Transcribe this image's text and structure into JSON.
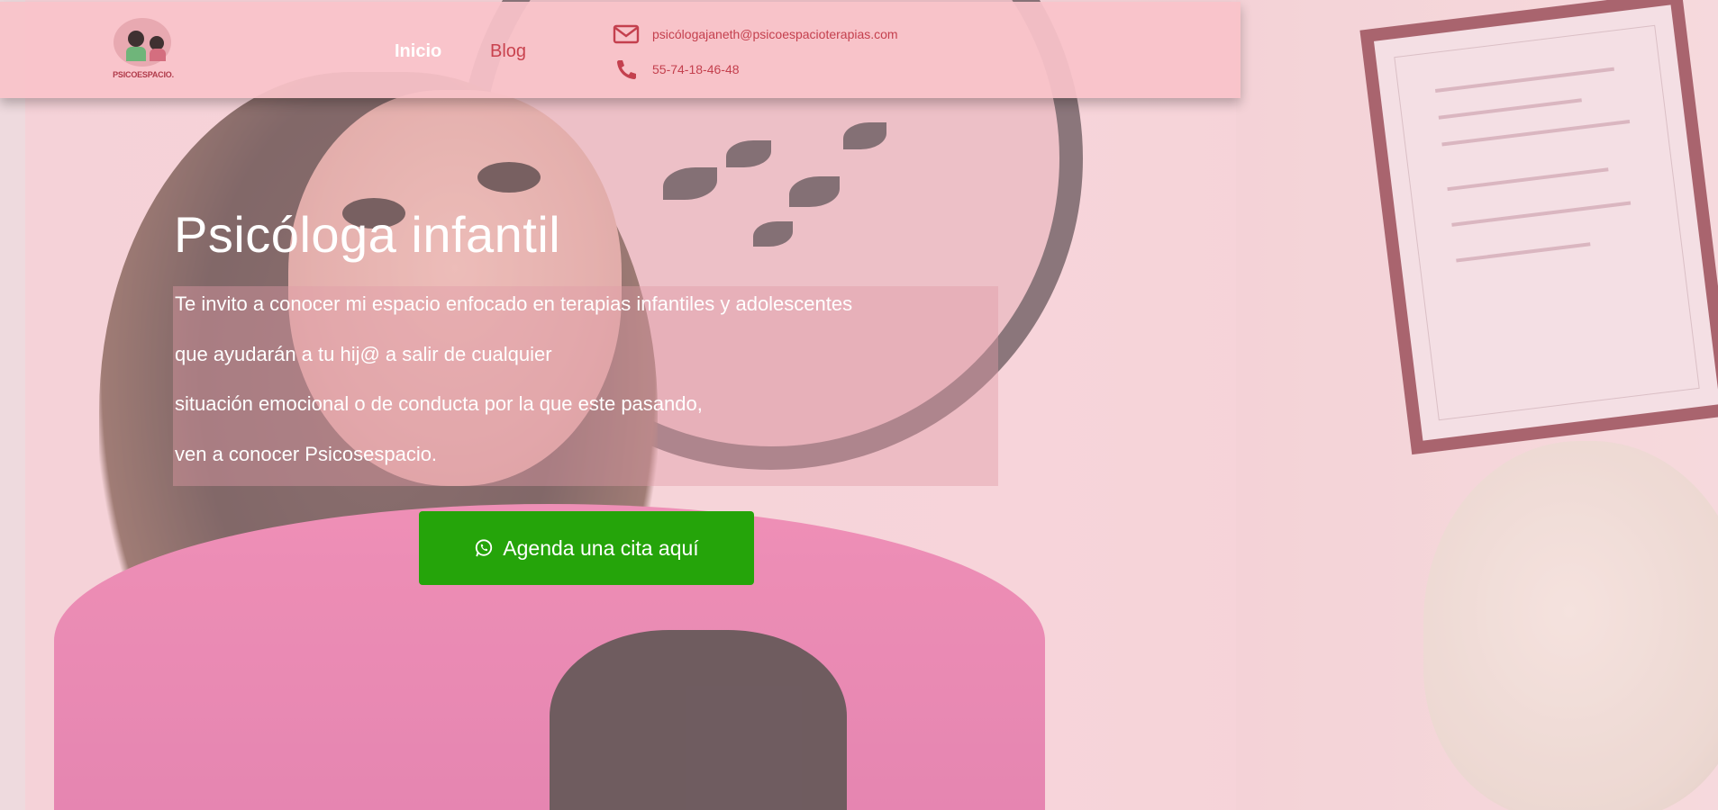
{
  "header": {
    "logo_text": "PSICOESPACIO.",
    "nav": [
      {
        "label": "Inicio"
      },
      {
        "label": "Blog"
      }
    ],
    "contact": {
      "email": "psicólogajaneth@psicoespacioterapias.com",
      "phone": "55-74-18-46-48",
      "email_icon": "envelope-icon",
      "phone_icon": "phone-icon"
    }
  },
  "hero": {
    "title": "Psicóloga infantil",
    "lines": [
      "Te  invito a conocer mi espacio enfocado en terapias infantiles  y adolescentes",
      "que ayudarán a tu hij@ a salir de cualquier",
      "situación emocional o de conducta  por la que este pasando,",
      "ven a conocer Psicosespacio."
    ],
    "cta_label": "Agenda una cita aquí",
    "cta_icon": "whatsapp-icon"
  },
  "colors": {
    "header_bg": "#f9c3c9",
    "accent": "#c9424e",
    "cta_bg": "#25a40a",
    "text_light": "#ffffff"
  }
}
